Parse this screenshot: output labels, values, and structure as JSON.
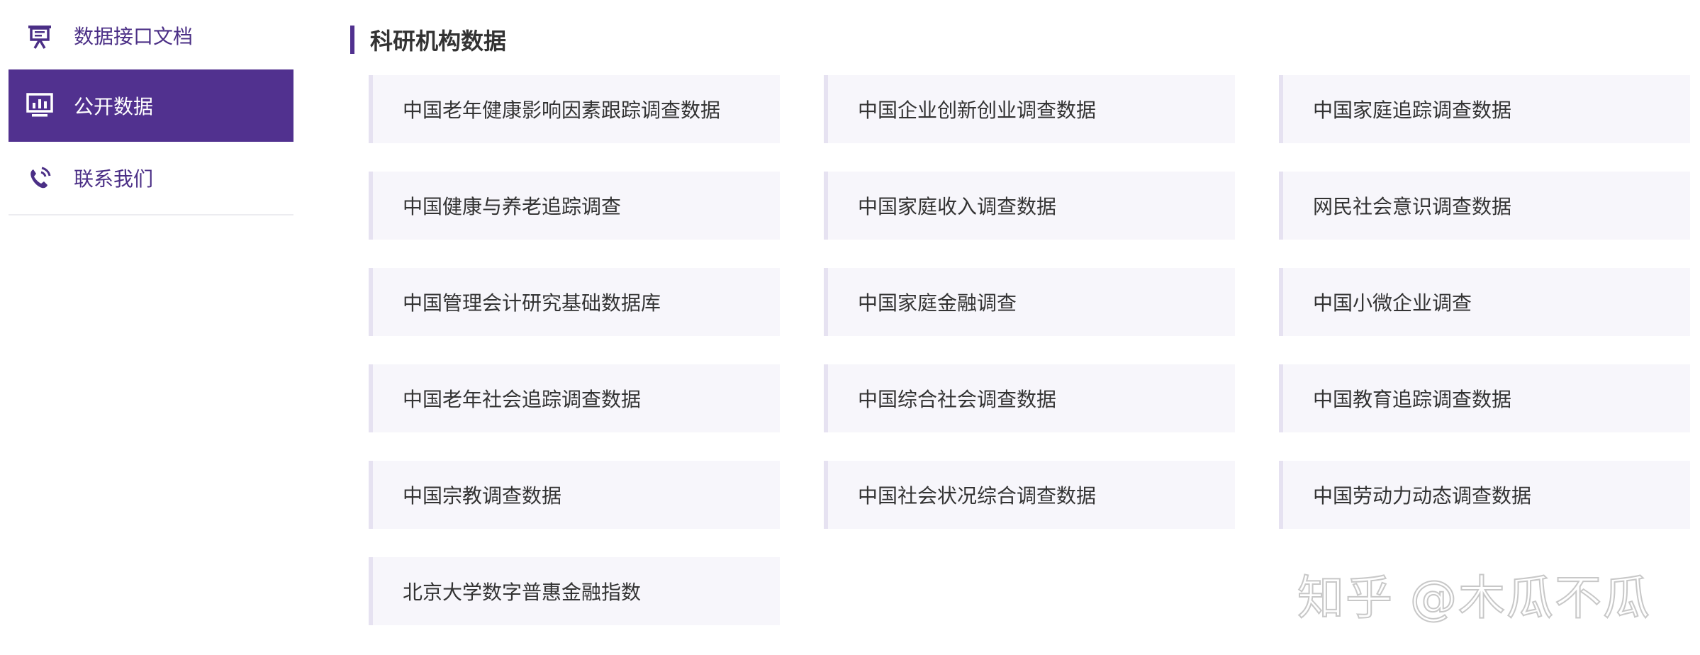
{
  "sidebar": {
    "items": [
      {
        "label": "数据接口文档",
        "icon": "presentation-board-icon",
        "active": false
      },
      {
        "label": "公开数据",
        "icon": "monitor-chart-icon",
        "active": true
      },
      {
        "label": "联系我们",
        "icon": "phone-ringing-icon",
        "active": false
      }
    ]
  },
  "main": {
    "section_title": "科研机构数据",
    "datasets": [
      "中国老年健康影响因素跟踪调查数据",
      "中国企业创新创业调查数据",
      "中国家庭追踪调查数据",
      "中国健康与养老追踪调查",
      "中国家庭收入调查数据",
      "网民社会意识调查数据",
      "中国管理会计研究基础数据库",
      "中国家庭金融调查",
      "中国小微企业调查",
      "中国老年社会追踪调查数据",
      "中国综合社会调查数据",
      "中国教育追踪调查数据",
      "中国宗教调查数据",
      "中国社会状况综合调查数据",
      "中国劳动力动态调查数据",
      "北京大学数字普惠金融指数"
    ]
  },
  "watermark": "知乎 @木瓜不瓜",
  "colors": {
    "accent": "#51318f",
    "card_background": "#f7f6fb",
    "card_border": "#e6e2f1"
  }
}
